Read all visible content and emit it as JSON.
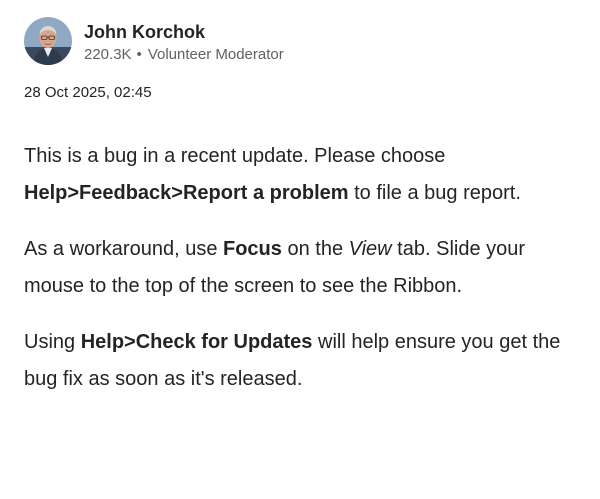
{
  "author": {
    "name": "John Korchok",
    "reputation": "220.3K",
    "separator": "•",
    "role": "Volunteer Moderator",
    "avatar_icon": "user-photo-avatar"
  },
  "post": {
    "timestamp": "28 Oct 2025, 02:45",
    "p1": {
      "t1": "This is a bug in a recent update. Please choose ",
      "b1": "Help>Feedback>Report a problem",
      "t2": " to file a bug report."
    },
    "p2": {
      "t1": "As a workaround, use ",
      "b1": "Focus",
      "t2": " on the ",
      "i1": "View",
      "t3": " tab. Slide your mouse to the top of the screen to see the Ribbon."
    },
    "p3": {
      "t1": "Using ",
      "b1": "Help>Check for Updates",
      "t2": " will help ensure you get the bug fix as soon as it's released."
    }
  },
  "colors": {
    "text": "#242424",
    "secondary_text": "#616161",
    "background": "#ffffff"
  }
}
